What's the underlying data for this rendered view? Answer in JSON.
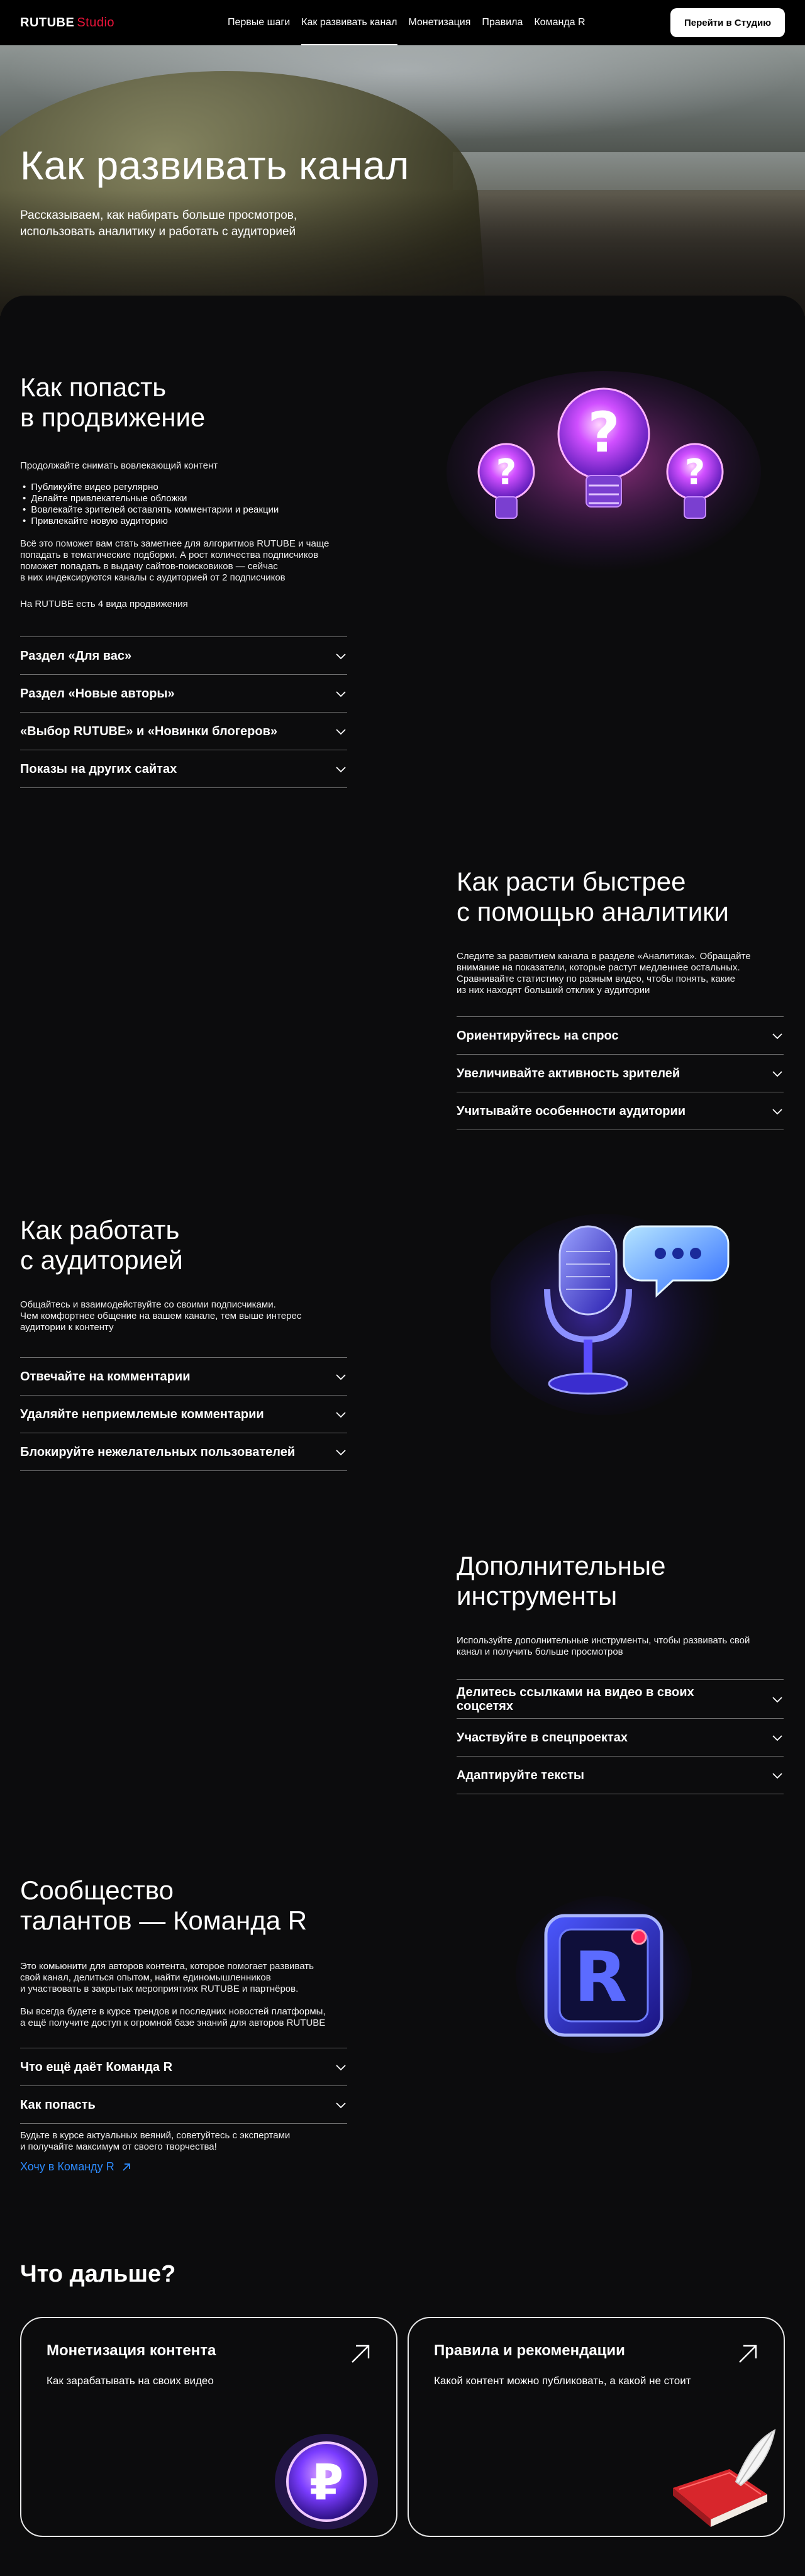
{
  "nav": {
    "logo_brand": "RUTUBE",
    "logo_studio": "Studio",
    "links": [
      "Первые шаги",
      "Как развивать канал",
      "Монетизация",
      "Правила",
      "Команда R"
    ],
    "active_index": 1,
    "cta": "Перейти в Студию"
  },
  "hero": {
    "title": "Как развивать канал",
    "subtitle_line1": "Рассказываем, как набирать больше просмотров,",
    "subtitle_line2": "использовать аналитику и работать с аудиторией"
  },
  "promo": {
    "title_line1": "Как попасть",
    "title_line2": "в продвижение",
    "lead": "Продолжайте снимать вовлекающий контент",
    "bullets": [
      "Публикуйте видео регулярно",
      "Делайте привлекательные обложки",
      "Вовлекайте зрителей оставлять комментарии и реакции",
      "Привлекайте новую аудиторию"
    ],
    "para_line1": "Всё это поможет вам стать заметнее для алгоритмов RUTUBE и чаще",
    "para_line2": "попадать в тематические подборки. А рост количества подписчиков",
    "para_line3": "поможет попадать в выдачу сайтов-поисковиков — сейчас",
    "para_line4": "в них индексируются каналы с аудиторией от 2 подписчиков",
    "types_note": "На RUTUBE есть 4 вида продвижения",
    "accordion": [
      "Раздел «Для вас»",
      "Раздел «Новые авторы»",
      "«Выбор RUTUBE» и «Новинки блогеров»",
      "Показы на других сайтах"
    ]
  },
  "analytics": {
    "title_line1": "Как расти быстрее",
    "title_line2": "с помощью аналитики",
    "text_line1": "Следите за развитием канала в разделе «Аналитика». Обращайте",
    "text_line2": "внимание на показатели, которые растут медленнее остальных.",
    "text_line3": "Сравнивайте статистику по разным видео, чтобы понять, какие",
    "text_line4": "из них находят больший отклик у аудитории",
    "accordion": [
      "Ориентируйтесь на спрос",
      "Увеличивайте активность зрителей",
      "Учитывайте особенности аудитории"
    ]
  },
  "audience": {
    "title_line1": "Как работать",
    "title_line2": "с аудиторией",
    "text_line1": "Общайтесь и взаимодействуйте со своими подписчиками.",
    "text_line2": "Чем комфортнее общение на вашем канале, тем выше интерес",
    "text_line3": "аудитории к контенту",
    "accordion": [
      "Отвечайте на комментарии",
      "Удаляйте неприемлемые комментарии",
      "Блокируйте нежелательных пользователей"
    ]
  },
  "tools": {
    "title_line1": "Дополнительные",
    "title_line2": "инструменты",
    "text_line1": "Используйте дополнительные инструменты, чтобы развивать свой",
    "text_line2": "канал и получить больше просмотров",
    "accordion": [
      "Делитесь ссылками на видео в своих соцсетях",
      "Участвуйте в спецпроектах",
      "Адаптируйте тексты"
    ]
  },
  "team": {
    "title_line1": "Сообщество",
    "title_line2": "талантов — Команда R",
    "text1_line1": "Это комьюнити для авторов контента, которое помогает развивать",
    "text1_line2": "свой канал, делиться опытом, найти единомышленников",
    "text1_line3": "и участвовать в закрытых мероприятиях RUTUBE и партнёров.",
    "text2_line1": "Вы всегда будете в курсе трендов и последних новостей платформы,",
    "text2_line2": "а ещё получите доступ к огромной базе знаний для авторов RUTUBE",
    "accordion": [
      "Что ещё даёт Команда R",
      "Как попасть"
    ],
    "after_line1": "Будьте в курсе актуальных веяний, советуйтесь с экспертами",
    "after_line2": "и получайте максимум от своего творчества!",
    "link": "Хочу в Команду R",
    "logo_letter": "R"
  },
  "next": {
    "title": "Что дальше?",
    "cards": [
      {
        "title": "Монетизация контента",
        "text": "Как зарабатывать на своих видео"
      },
      {
        "title": "Правила и рекомендации",
        "text": "Какой контент можно публиковать, а какой не стоит"
      }
    ]
  },
  "colors": {
    "accent_red": "#ed143b",
    "link_blue": "#2d8cff",
    "background": "#0c0c0d"
  }
}
